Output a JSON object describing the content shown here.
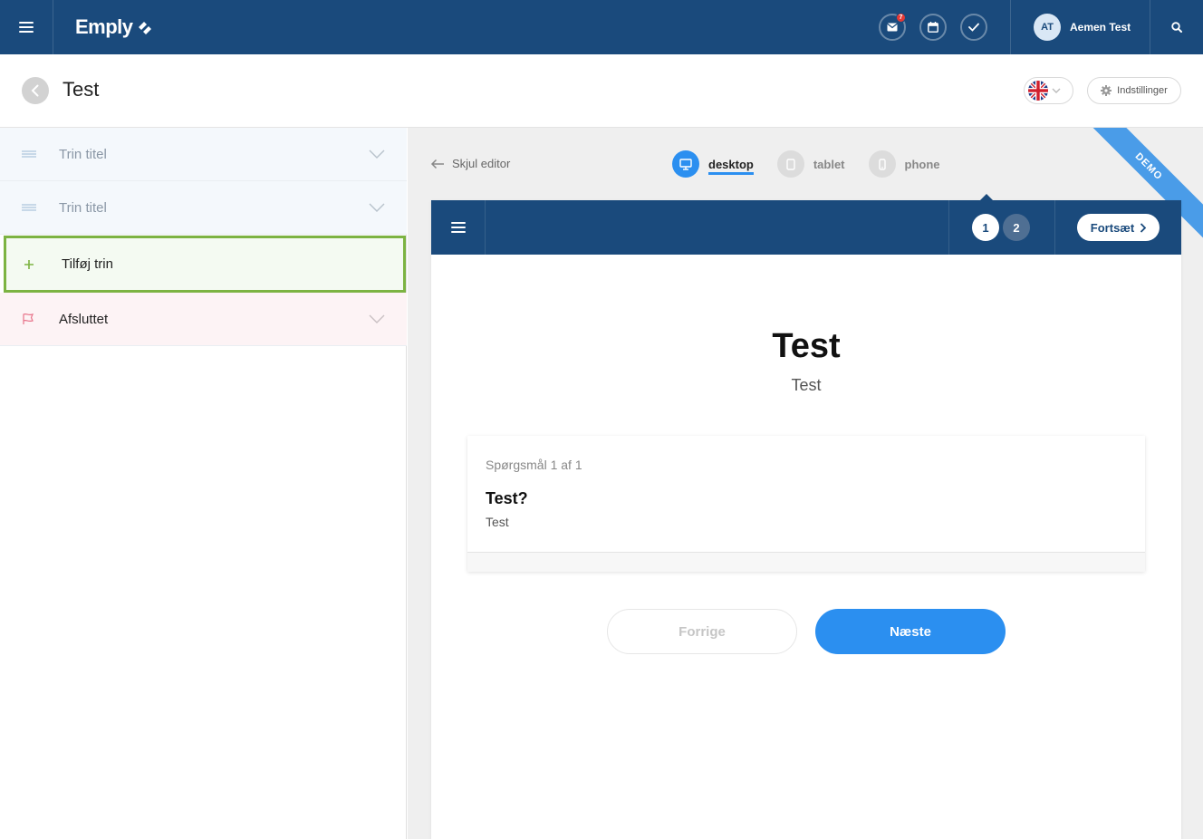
{
  "topbar": {
    "logo": "Emply",
    "mail_badge": "7",
    "user_initials": "AT",
    "user_name": "Aemen Test"
  },
  "page": {
    "title": "Test",
    "settings_label": "Indstillinger"
  },
  "steps": [
    {
      "label": "Trin titel"
    },
    {
      "label": "Trin titel"
    },
    {
      "label": "Tilføj trin"
    },
    {
      "label": "Afsluttet"
    }
  ],
  "preview": {
    "hide_editor": "Skjul editor",
    "devices": [
      {
        "label": "desktop",
        "active": true
      },
      {
        "label": "tablet",
        "active": false
      },
      {
        "label": "phone",
        "active": false
      }
    ],
    "ribbon": "DEMO",
    "step_numbers": [
      "1",
      "2"
    ],
    "continue_label": "Fortsæt",
    "form_title": "Test",
    "form_subtitle": "Test",
    "question_meta": "Spørgsmål 1 af 1",
    "question_title": "Test?",
    "question_desc": "Test",
    "prev_label": "Forrige",
    "next_label": "Næste"
  },
  "colors": {
    "brand": "#1a4a7c",
    "accent": "#2b8ff0",
    "add_border": "#7cb342"
  }
}
